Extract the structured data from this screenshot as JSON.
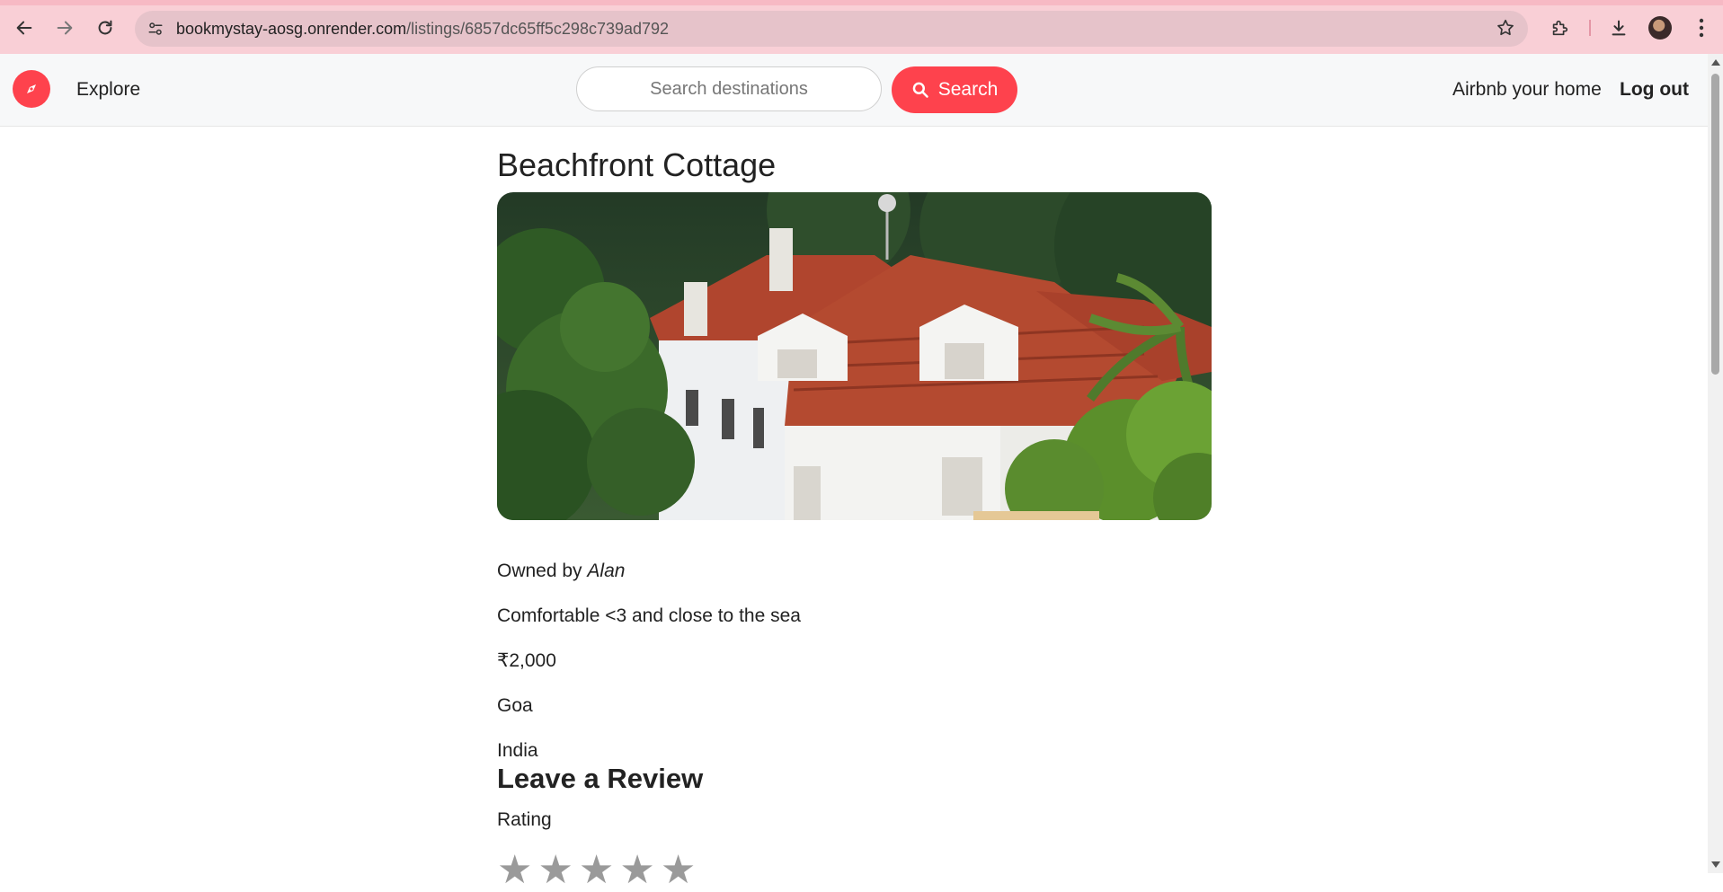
{
  "browser": {
    "url_host": "bookmystay-aosg.onrender.com",
    "url_path": "/listings/6857dc65ff5c298c739ad792"
  },
  "nav": {
    "explore": "Explore",
    "search_placeholder": "Search destinations",
    "search_button": "Search",
    "host_link": "Airbnb your home",
    "logout": "Log out",
    "brand_color": "#fe424d"
  },
  "listing": {
    "title": "Beachfront Cottage",
    "owner_prefix": "Owned by ",
    "owner": "Alan",
    "description": "Comfortable <3 and close to the sea",
    "price": "₹2,000",
    "location": "Goa",
    "country": "India"
  },
  "review": {
    "heading": "Leave a Review",
    "rating_label": "Rating",
    "stars": [
      "★",
      "★",
      "★",
      "★",
      "★"
    ]
  }
}
